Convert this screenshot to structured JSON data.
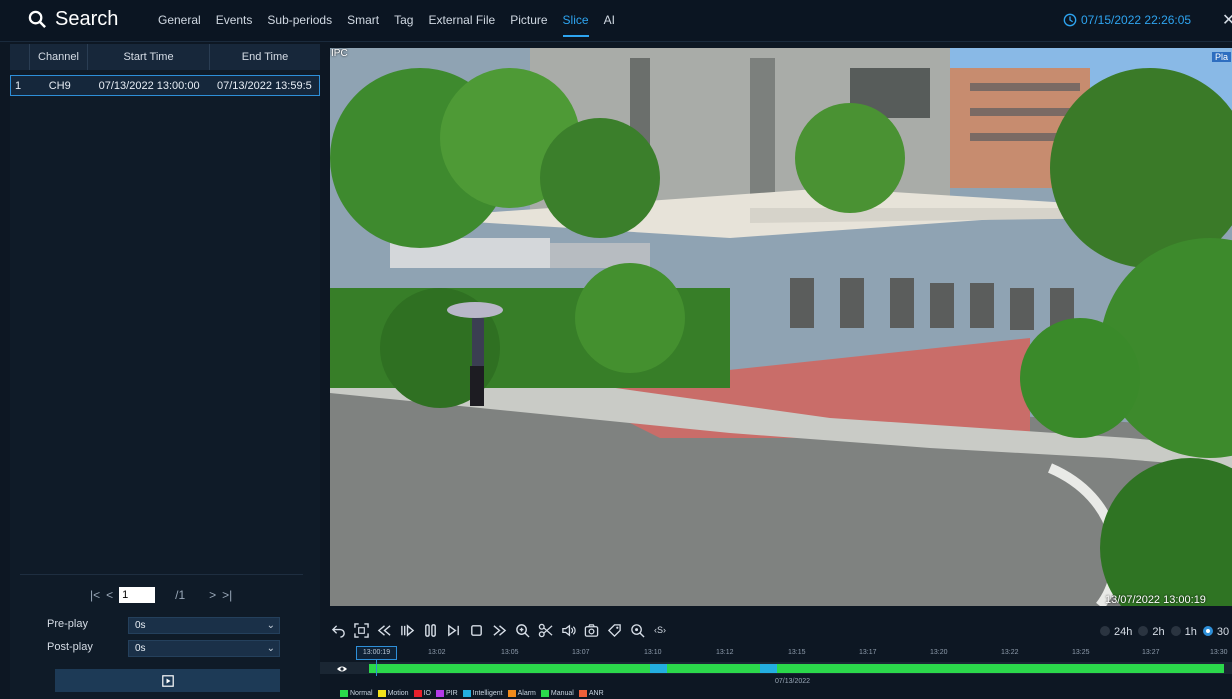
{
  "header": {
    "title": "Search",
    "tabs": [
      {
        "label": "General",
        "active": false
      },
      {
        "label": "Events",
        "active": false
      },
      {
        "label": "Sub-periods",
        "active": false
      },
      {
        "label": "Smart",
        "active": false
      },
      {
        "label": "Tag",
        "active": false
      },
      {
        "label": "External File",
        "active": false
      },
      {
        "label": "Picture",
        "active": false
      },
      {
        "label": "Slice",
        "active": true
      },
      {
        "label": "AI",
        "active": false
      }
    ],
    "datetime": "07/15/2022 22:26:05",
    "icons": {
      "search": "search-icon",
      "clock": "clock-icon",
      "close": "close-icon"
    },
    "accent_color": "#2ea4f0"
  },
  "table": {
    "headers": [
      "",
      "Channel",
      "Start Time",
      "End Time"
    ],
    "rows": [
      {
        "index": "1",
        "channel": "CH9",
        "start": "07/13/2022 13:00:00",
        "end": "07/13/2022 13:59:5"
      }
    ]
  },
  "pager": {
    "first": "|<",
    "prev": "<",
    "current": "1",
    "total": "/1",
    "next": ">",
    "last": ">|"
  },
  "settings": {
    "preplay_label": "Pre-play",
    "preplay_value": "0s",
    "postplay_label": "Post-play",
    "postplay_value": "0s"
  },
  "video": {
    "osd_left": "IPC",
    "osd_right": "Pla",
    "timestamp": "13/07/2022 13:00:19"
  },
  "playback": {
    "controls": [
      "back-icon",
      "fullscreen-icon",
      "rewind-icon",
      "slow-play-icon",
      "pause-icon",
      "step-icon",
      "stop-icon",
      "fast-forward-icon",
      "zoom-icon",
      "clip-icon",
      "audio-icon",
      "snapshot-icon",
      "tag-icon",
      "smart-search-icon",
      "speed-icon"
    ],
    "speed_label": "S",
    "zoom_options": [
      {
        "label": "24h",
        "selected": false
      },
      {
        "label": "2h",
        "selected": false
      },
      {
        "label": "1h",
        "selected": false
      },
      {
        "label": "30",
        "selected": true
      }
    ],
    "cursor_time": "13:00:19",
    "ticks": [
      "13:02",
      "13:05",
      "13:07",
      "13:10",
      "13:12",
      "13:15",
      "13:17",
      "13:20",
      "13:22",
      "13:25",
      "13:27",
      "13:30"
    ],
    "date": "07/13/2022",
    "record_color_normal": "#2bd84b",
    "record_color_intelligent": "#23aee0",
    "legend": [
      {
        "label": "Normal",
        "color": "#2bd84b"
      },
      {
        "label": "Motion",
        "color": "#f4e21b"
      },
      {
        "label": "IO",
        "color": "#e81f2a"
      },
      {
        "label": "PIR",
        "color": "#b43ae8"
      },
      {
        "label": "Intelligent",
        "color": "#23aee0"
      },
      {
        "label": "Alarm",
        "color": "#f08a1c"
      },
      {
        "label": "Manual",
        "color": "#2bd84b"
      },
      {
        "label": "ANR",
        "color": "#f0603a"
      }
    ]
  }
}
